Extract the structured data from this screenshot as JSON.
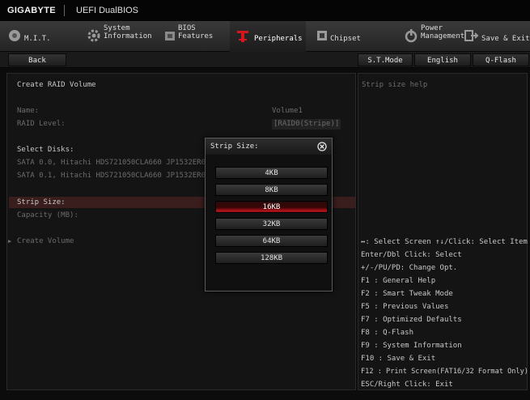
{
  "brand": {
    "logo": "GIGABYTE",
    "title": "UEFI DualBIOS"
  },
  "tabs": [
    {
      "label": "M.I.T."
    },
    {
      "label": "System\nInformation"
    },
    {
      "label": "BIOS\nFeatures"
    },
    {
      "label": "Peripherals",
      "active": true
    },
    {
      "label": "Chipset"
    },
    {
      "label": "Power\nManagement"
    },
    {
      "label": "Save & Exit"
    }
  ],
  "subbar": {
    "back": "Back",
    "st_mode": "S.T.Mode",
    "language": "English",
    "qflash": "Q-Flash"
  },
  "left": {
    "heading": "Create RAID Volume",
    "name_label": "Name:",
    "name_value": "Volume1",
    "raid_level_label": "RAID Level:",
    "raid_level_value": "[RAID0(Stripe)]",
    "select_disks": "Select Disks:",
    "disks": [
      "SATA 0.0, Hitachi HDS721050CLA660 JP1532ER046F",
      "SATA 0.1, Hitachi HDS721050CLA660 JP1532ER04EJ"
    ],
    "strip_size_label": "Strip Size:",
    "capacity_label": "Capacity (MB):",
    "create_volume": "Create Volume"
  },
  "dialog": {
    "title": "Strip Size:",
    "options": [
      "4KB",
      "8KB",
      "16KB",
      "32KB",
      "64KB",
      "128KB"
    ],
    "selected": "16KB"
  },
  "right": {
    "help_title": "Strip size help",
    "shortcuts": [
      "↔: Select Screen  ↑↓/Click: Select Item",
      "Enter/Dbl Click: Select",
      "+/-/PU/PD: Change Opt.",
      "F1  : General Help",
      "F2  : Smart Tweak Mode",
      "F5  : Previous Values",
      "F7  : Optimized Defaults",
      "F8  : Q-Flash",
      "F9  : System Information",
      "F10 : Save & Exit",
      "F12 : Print Screen(FAT16/32 Format Only)",
      "ESC/Right Click: Exit"
    ]
  },
  "colors": {
    "accent": "#c0151b",
    "background": "#0c0c0c",
    "text": "#bdbdbd"
  },
  "icons": [
    "mit-icon",
    "gear-icon",
    "bios-chip-icon",
    "peripherals-icon",
    "chipset-icon",
    "power-icon",
    "exit-icon",
    "close-icon",
    "expand-arrow-icon"
  ]
}
